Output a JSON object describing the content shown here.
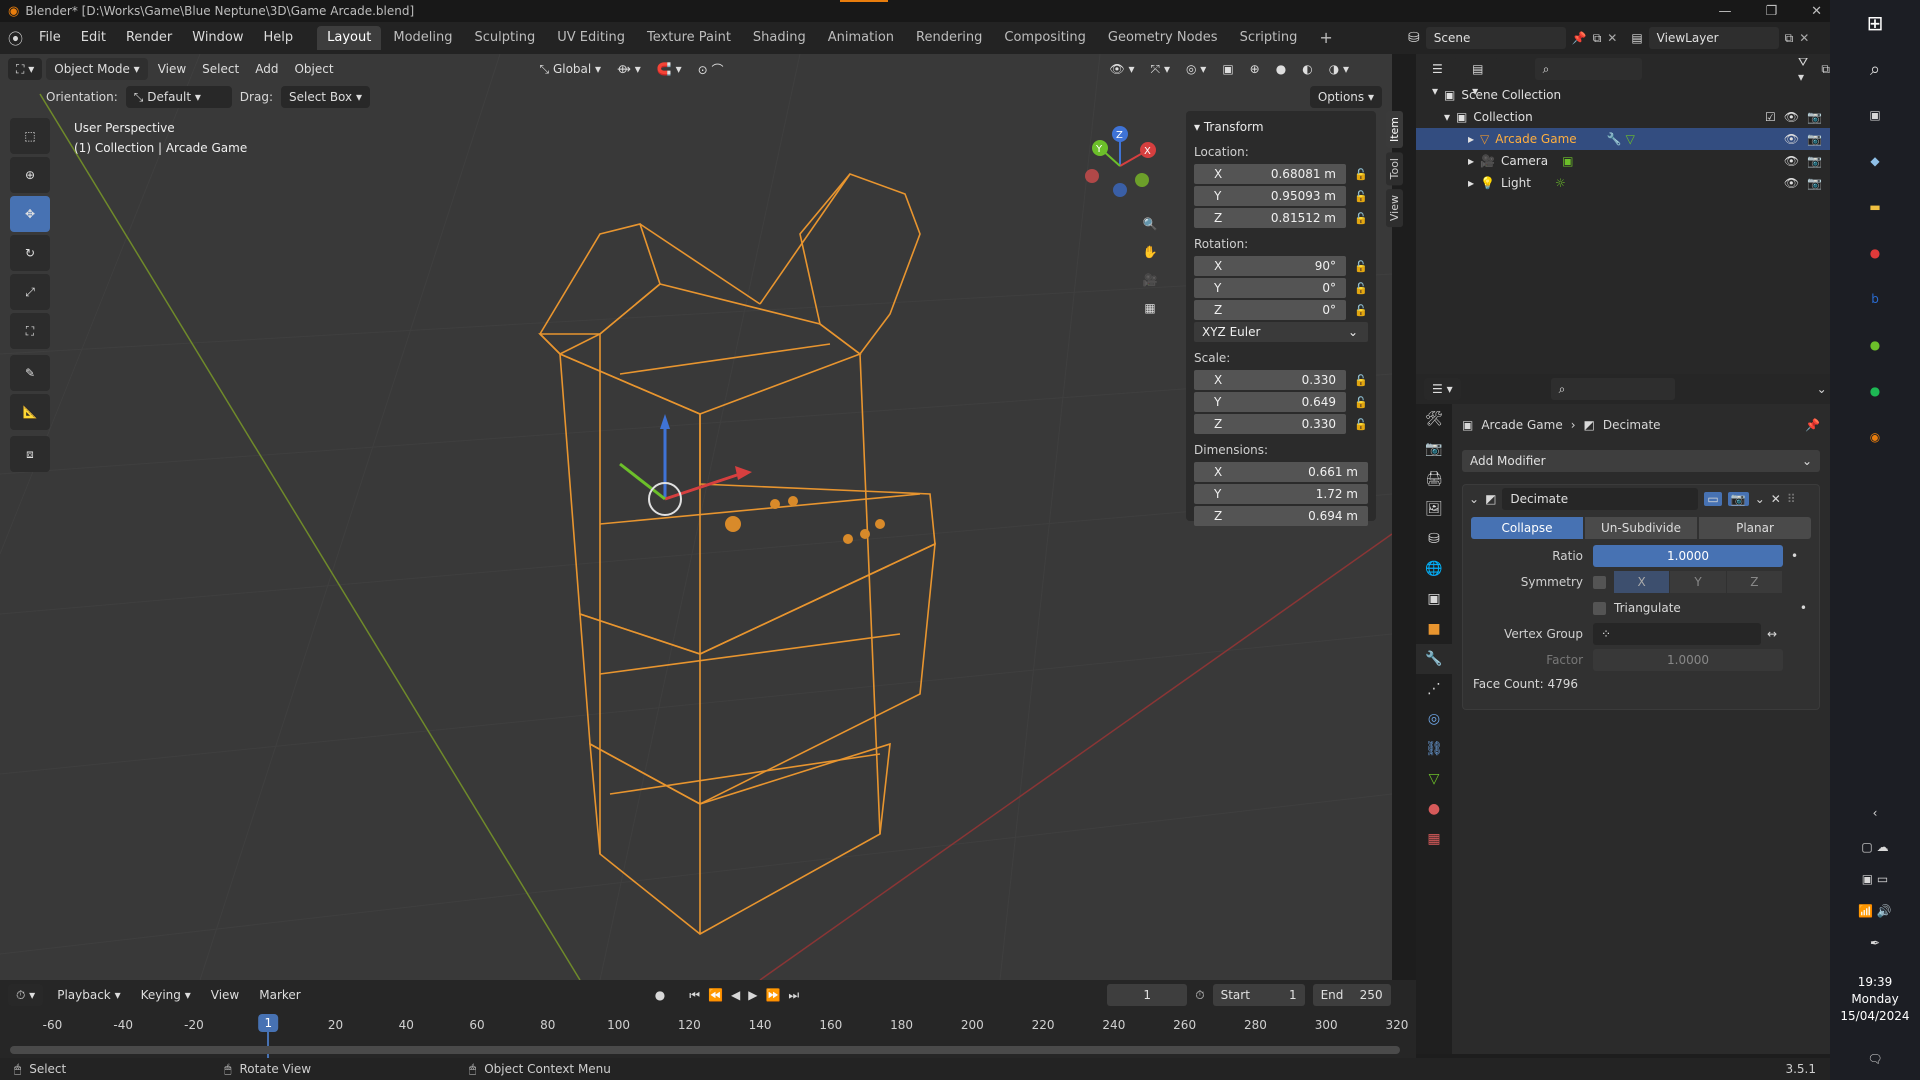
{
  "window": {
    "title": "Blender* [D:\\Works\\Game\\Blue Neptune\\3D\\Game Arcade.blend]",
    "accent_color": "#e87d0d"
  },
  "menu": [
    "File",
    "Edit",
    "Render",
    "Window",
    "Help"
  ],
  "workspaces": [
    {
      "label": "Layout",
      "active": true
    },
    {
      "label": "Modeling"
    },
    {
      "label": "Sculpting"
    },
    {
      "label": "UV Editing"
    },
    {
      "label": "Texture Paint"
    },
    {
      "label": "Shading"
    },
    {
      "label": "Animation"
    },
    {
      "label": "Rendering"
    },
    {
      "label": "Compositing"
    },
    {
      "label": "Geometry Nodes"
    },
    {
      "label": "Scripting"
    }
  ],
  "scene": {
    "name": "Scene",
    "view_layer": "ViewLayer"
  },
  "viewport": {
    "mode": "Object Mode",
    "menus": [
      "View",
      "Select",
      "Add",
      "Object"
    ],
    "transform_orientation": "Global",
    "orientation_label": "Orientation:",
    "orientation_value": "Default",
    "drag_label": "Drag:",
    "drag_value": "Select Box",
    "options_label": "Options",
    "perspective": "User Perspective",
    "collection_info": "(1) Collection | Arcade Game",
    "wire_color": "#e8952f"
  },
  "npanel": {
    "section": "Transform",
    "location_label": "Location:",
    "location": [
      {
        "axis": "X",
        "value": "0.68081 m"
      },
      {
        "axis": "Y",
        "value": "0.95093 m"
      },
      {
        "axis": "Z",
        "value": "0.81512 m"
      }
    ],
    "rotation_label": "Rotation:",
    "rotation": [
      {
        "axis": "X",
        "value": "90°"
      },
      {
        "axis": "Y",
        "value": "0°"
      },
      {
        "axis": "Z",
        "value": "0°"
      }
    ],
    "rotation_mode": "XYZ Euler",
    "scale_label": "Scale:",
    "scale": [
      {
        "axis": "X",
        "value": "0.330"
      },
      {
        "axis": "Y",
        "value": "0.649"
      },
      {
        "axis": "Z",
        "value": "0.330"
      }
    ],
    "dimensions_label": "Dimensions:",
    "dimensions": [
      {
        "axis": "X",
        "value": "0.661 m"
      },
      {
        "axis": "Y",
        "value": "1.72 m"
      },
      {
        "axis": "Z",
        "value": "0.694 m"
      }
    ],
    "tabs": [
      "Item",
      "Tool",
      "View"
    ]
  },
  "outliner": {
    "root": "Scene Collection",
    "collection": "Collection",
    "items": [
      {
        "name": "Arcade Game",
        "selected": true
      },
      {
        "name": "Camera"
      },
      {
        "name": "Light"
      }
    ]
  },
  "properties": {
    "breadcrumb_object": "Arcade Game",
    "breadcrumb_modifier": "Decimate",
    "add_modifier": "Add Modifier",
    "modifier_name": "Decimate",
    "modes": [
      {
        "label": "Collapse",
        "active": true
      },
      {
        "label": "Un-Subdivide"
      },
      {
        "label": "Planar"
      }
    ],
    "ratio_label": "Ratio",
    "ratio_value": "1.0000",
    "symmetry_label": "Symmetry",
    "symmetry_axes": [
      "X",
      "Y",
      "Z"
    ],
    "triangulate_label": "Triangulate",
    "vertex_group_label": "Vertex Group",
    "factor_label": "Factor",
    "factor_value": "1.0000",
    "face_count": "Face Count: 4796"
  },
  "timeline": {
    "menus": [
      "Playback",
      "Keying",
      "View",
      "Marker"
    ],
    "current_frame": "1",
    "start_label": "Start",
    "start": "1",
    "end_label": "End",
    "end": "250",
    "ticks": [
      -60,
      -40,
      -20,
      1,
      20,
      40,
      60,
      80,
      100,
      120,
      140,
      160,
      180,
      200,
      220,
      240,
      260,
      280,
      300,
      320
    ]
  },
  "status": {
    "select": "Select",
    "rotate": "Rotate View",
    "context": "Object Context Menu",
    "version": "3.5.1"
  },
  "clock": {
    "time": "19:39",
    "day": "Monday",
    "date": "15/04/2024"
  }
}
